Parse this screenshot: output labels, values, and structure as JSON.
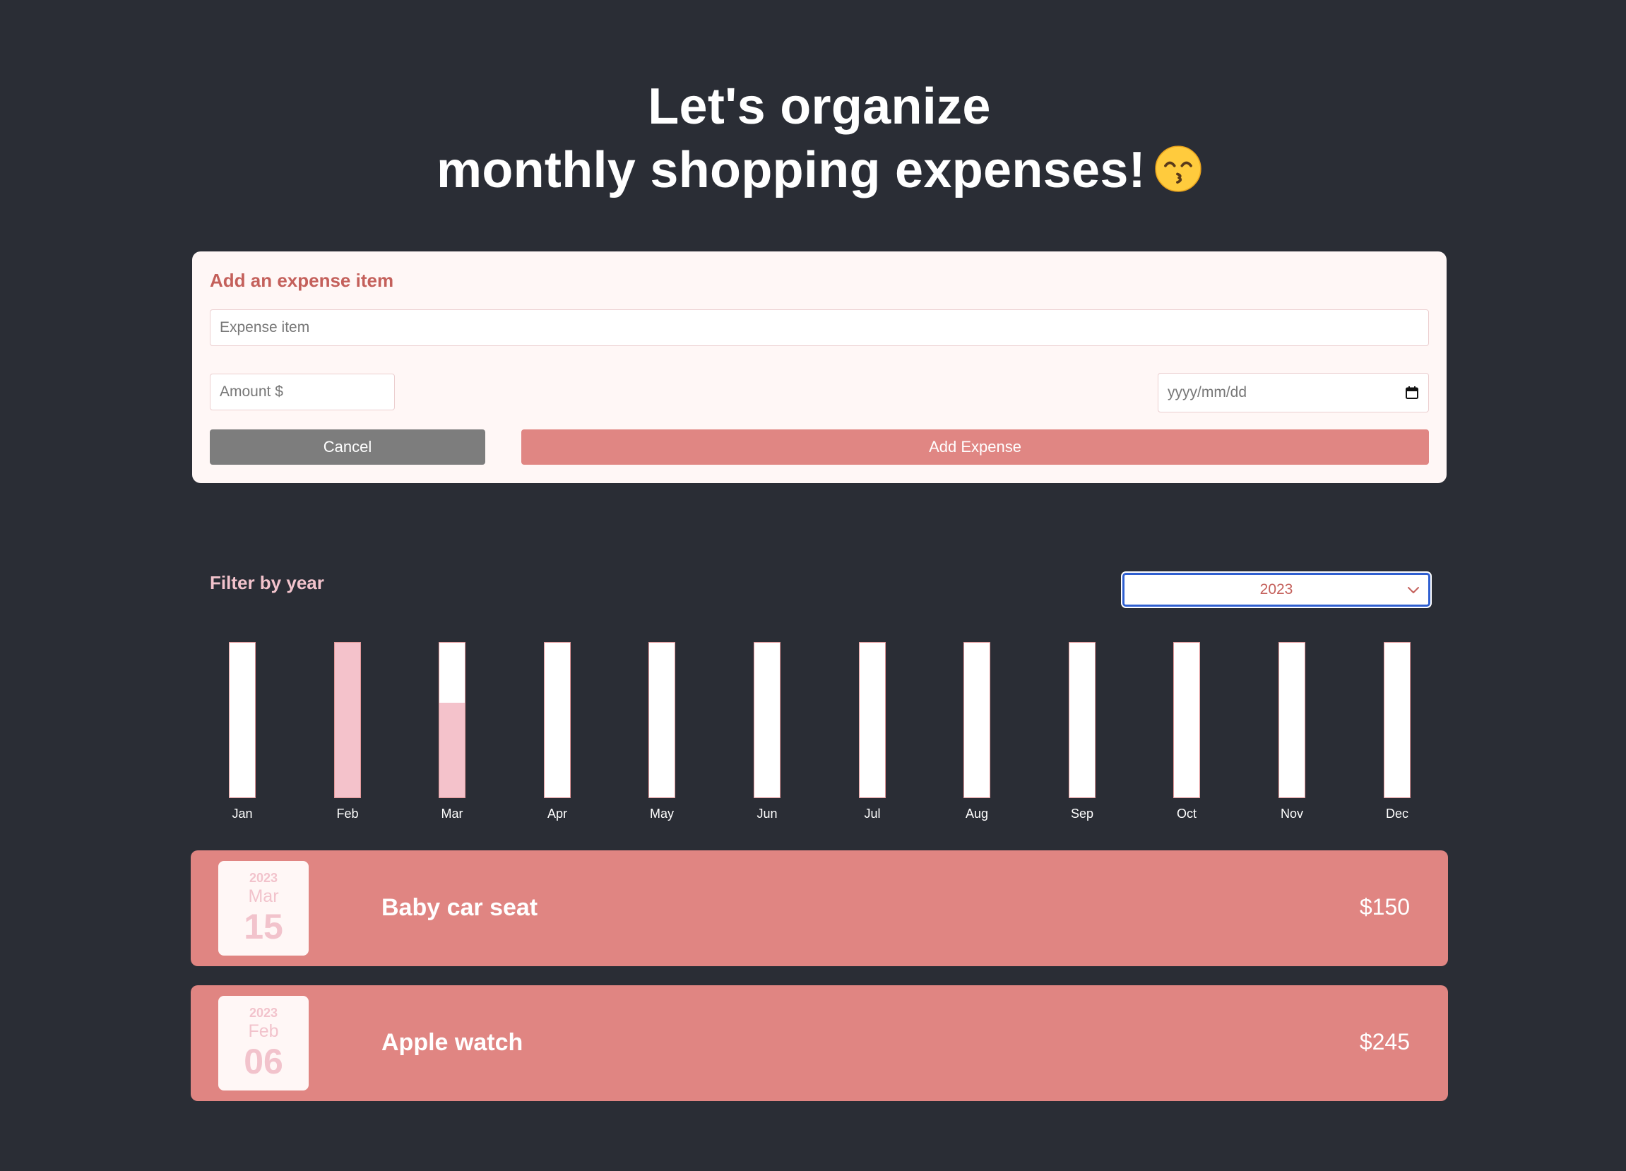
{
  "header": {
    "title_line1": "Let's organize",
    "title_line2": "monthly shopping expenses!",
    "emoji": "kissing-face-smiling-eyes-icon"
  },
  "form": {
    "title": "Add an expense item",
    "item_placeholder": "Expense item",
    "amount_placeholder": "Amount $",
    "date_placeholder": "yyyy/mm/dd",
    "calendar_icon": "calendar-icon",
    "cancel_label": "Cancel",
    "add_label": "Add Expense"
  },
  "filter": {
    "label": "Filter by year",
    "selected_year": "2023",
    "dropdown_icon": "chevron-down-icon"
  },
  "chart_data": {
    "type": "bar",
    "categories": [
      "Jan",
      "Feb",
      "Mar",
      "Apr",
      "May",
      "Jun",
      "Jul",
      "Aug",
      "Sep",
      "Oct",
      "Nov",
      "Dec"
    ],
    "values": [
      0,
      245,
      150,
      0,
      0,
      0,
      0,
      0,
      0,
      0,
      0,
      0
    ],
    "ylim": [
      0,
      245
    ]
  },
  "expenses": [
    {
      "year": "2023",
      "month": "Mar",
      "day": "15",
      "title": "Baby car seat",
      "amount": "$150"
    },
    {
      "year": "2023",
      "month": "Feb",
      "day": "06",
      "title": "Apple watch",
      "amount": "$245"
    }
  ],
  "colors": {
    "background": "#2a2d35",
    "card": "#fff7f6",
    "accent": "#e08683",
    "accent_text": "#c4605b",
    "pink_light": "#f4c2cb",
    "cancel_button": "#7d7d7d",
    "select_focus": "#2f5fd0"
  }
}
